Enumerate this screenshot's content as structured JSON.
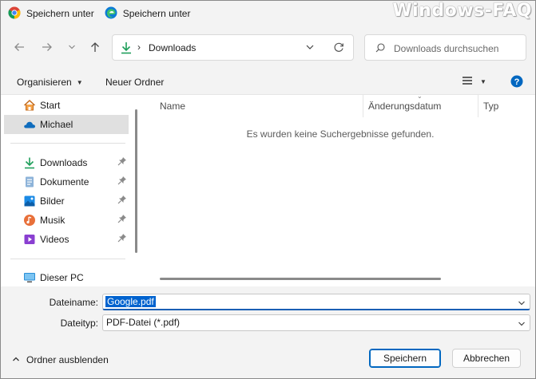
{
  "tabs": [
    {
      "title": "Speichern unter",
      "icon": "chrome-icon"
    },
    {
      "title": "Speichern unter",
      "icon": "edge-icon"
    }
  ],
  "watermark": "Windows-FAQ",
  "address": {
    "path": "Downloads"
  },
  "search": {
    "placeholder": "Downloads durchsuchen"
  },
  "commands": {
    "organize": "Organisieren",
    "new_folder": "Neuer Ordner"
  },
  "sidebar": {
    "top": [
      {
        "label": "Start",
        "icon": "home-icon"
      },
      {
        "label": "Michael",
        "icon": "onedrive-cloud-icon",
        "selected": true
      }
    ],
    "quick": [
      {
        "label": "Downloads",
        "icon": "download-icon",
        "pinned": true
      },
      {
        "label": "Dokumente",
        "icon": "documents-icon",
        "pinned": true
      },
      {
        "label": "Bilder",
        "icon": "pictures-icon",
        "pinned": true
      },
      {
        "label": "Musik",
        "icon": "music-icon",
        "pinned": true
      },
      {
        "label": "Videos",
        "icon": "videos-icon",
        "pinned": true
      }
    ],
    "pc": [
      {
        "label": "Dieser PC",
        "icon": "computer-icon"
      }
    ]
  },
  "columns": [
    "Name",
    "Änderungsdatum",
    "Typ"
  ],
  "empty_message": "Es wurden keine Suchergebnisse gefunden.",
  "fields": {
    "filename_label": "Dateiname:",
    "filename_value": "Google.pdf",
    "filetype_label": "Dateityp:",
    "filetype_value": "PDF-Datei (*.pdf)"
  },
  "footer": {
    "hide_folders": "Ordner ausblenden",
    "save": "Speichern",
    "cancel": "Abbrechen"
  },
  "colors": {
    "accent": "#0067c0",
    "selection": "#0063cf",
    "help": "#0067c0"
  }
}
